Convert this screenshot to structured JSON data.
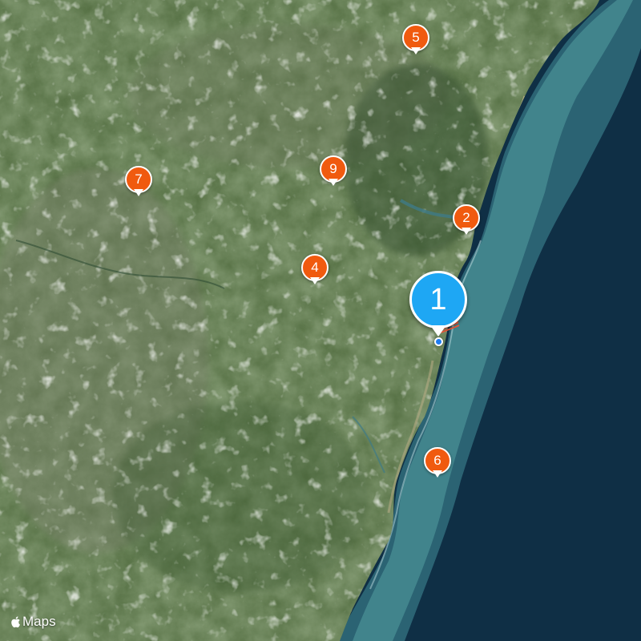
{
  "colors": {
    "ocean_deep": "#0f2f45",
    "ocean_shelf": "#3d7f87",
    "land": "#4f6b3c",
    "pin_orange": "#f05a0f",
    "pin_blue": "#1ea7f4",
    "user_location": "#1e7cf2"
  },
  "pins": [
    {
      "label": "5",
      "style": "orange"
    },
    {
      "label": "9",
      "style": "orange"
    },
    {
      "label": "7",
      "style": "orange"
    },
    {
      "label": "2",
      "style": "orange"
    },
    {
      "label": "4",
      "style": "orange"
    },
    {
      "label": "6",
      "style": "orange"
    },
    {
      "label": "1",
      "style": "blue",
      "selected": true
    }
  ],
  "attribution": {
    "icon": "apple-logo-icon",
    "text": "Maps"
  }
}
